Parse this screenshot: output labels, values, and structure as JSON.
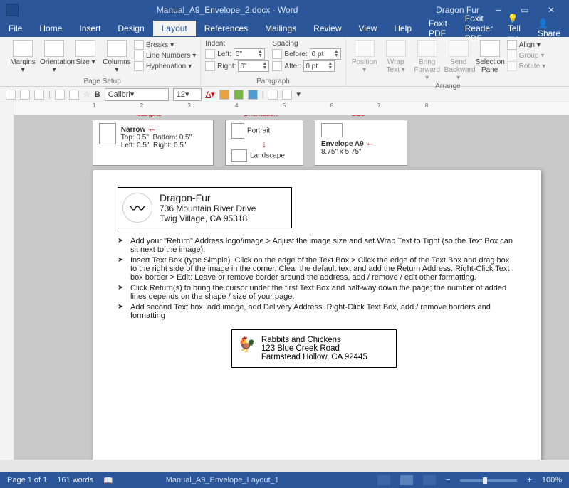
{
  "titlebar": {
    "doc": "Manual_A9_Envelope_2.docx - Word",
    "user": "Dragon Fur"
  },
  "tabs": {
    "file": "File",
    "home": "Home",
    "insert": "Insert",
    "design": "Design",
    "layout": "Layout",
    "references": "References",
    "mailings": "Mailings",
    "review": "Review",
    "view": "View",
    "help": "Help",
    "foxit": "Foxit PDF",
    "foxitreader": "Foxit Reader PDF",
    "tell": "Tell me",
    "share": "Share"
  },
  "ribbon": {
    "pagesetup": {
      "label": "Page Setup",
      "margins": "Margins",
      "orientation": "Orientation",
      "size": "Size",
      "columns": "Columns",
      "breaks": "Breaks",
      "linenum": "Line Numbers",
      "hyphen": "Hyphenation"
    },
    "paragraph": {
      "label": "Paragraph",
      "indent": "Indent",
      "spacing": "Spacing",
      "left": "Left:",
      "right": "Right:",
      "before": "Before:",
      "after": "After:",
      "left_v": "0\"",
      "right_v": "0\"",
      "before_v": "0 pt",
      "after_v": "0 pt"
    },
    "arrange": {
      "label": "Arrange",
      "position": "Position",
      "wrap": "Wrap Text",
      "bringf": "Bring Forward",
      "sendb": "Send Backward",
      "selpane": "Selection Pane",
      "align": "Align",
      "group": "Group",
      "rotate": "Rotate"
    }
  },
  "qat": {
    "font": "Calibri",
    "size": "12"
  },
  "annot": {
    "margins": {
      "hdr": "Margins",
      "name": "Narrow",
      "top": "Top:",
      "top_v": "0.5\"",
      "bottom": "Bottom: 0.5\"",
      "left": "Left:",
      "left_v": "0.5\"",
      "right": "Right:    0.5\""
    },
    "orient": {
      "hdr": "Orientation",
      "portrait": "Portrait",
      "landscape": "Landscape"
    },
    "size": {
      "hdr": "Size",
      "name": "Envelope A9",
      "dim": "8.75\" x 5.75\""
    }
  },
  "return_addr": {
    "name": "Dragon-Fur",
    "street": "736 Mountain River Drive",
    "city": "Twig Village, CA 95318"
  },
  "bullets": {
    "b1": "Add your \"Return\" Address logo/image > Adjust the image size and set Wrap Text to Tight (so the Text Box can sit next to the image).",
    "b2": "Insert Text Box (type Simple).  Click on the edge of the Text Box > Click the edge of the Text Box and drag box to the right side of the image in the corner.  Clear the default text and add the Return Address.  Right-Click Text box border > Edit:  Leave or remove border around the address, add / remove / edit other formatting.",
    "b3": "Click Return(s) to bring the cursor under the first Text Box and half-way down the page; the number of added lines depends on the shape / size of your page.",
    "b4": "Add second Text box, add image, add Delivery Address.  Right-Click Text Box, add / remove borders and formatting"
  },
  "deliver_addr": {
    "name": "Rabbits and Chickens",
    "street": "123 Blue Creek Road",
    "city": "Farmstead Hollow, CA 92445"
  },
  "status": {
    "page": "Page 1 of 1",
    "words": "161 words",
    "fname": "Manual_A9_Envelope_Layout_1",
    "zoom": "100%"
  }
}
